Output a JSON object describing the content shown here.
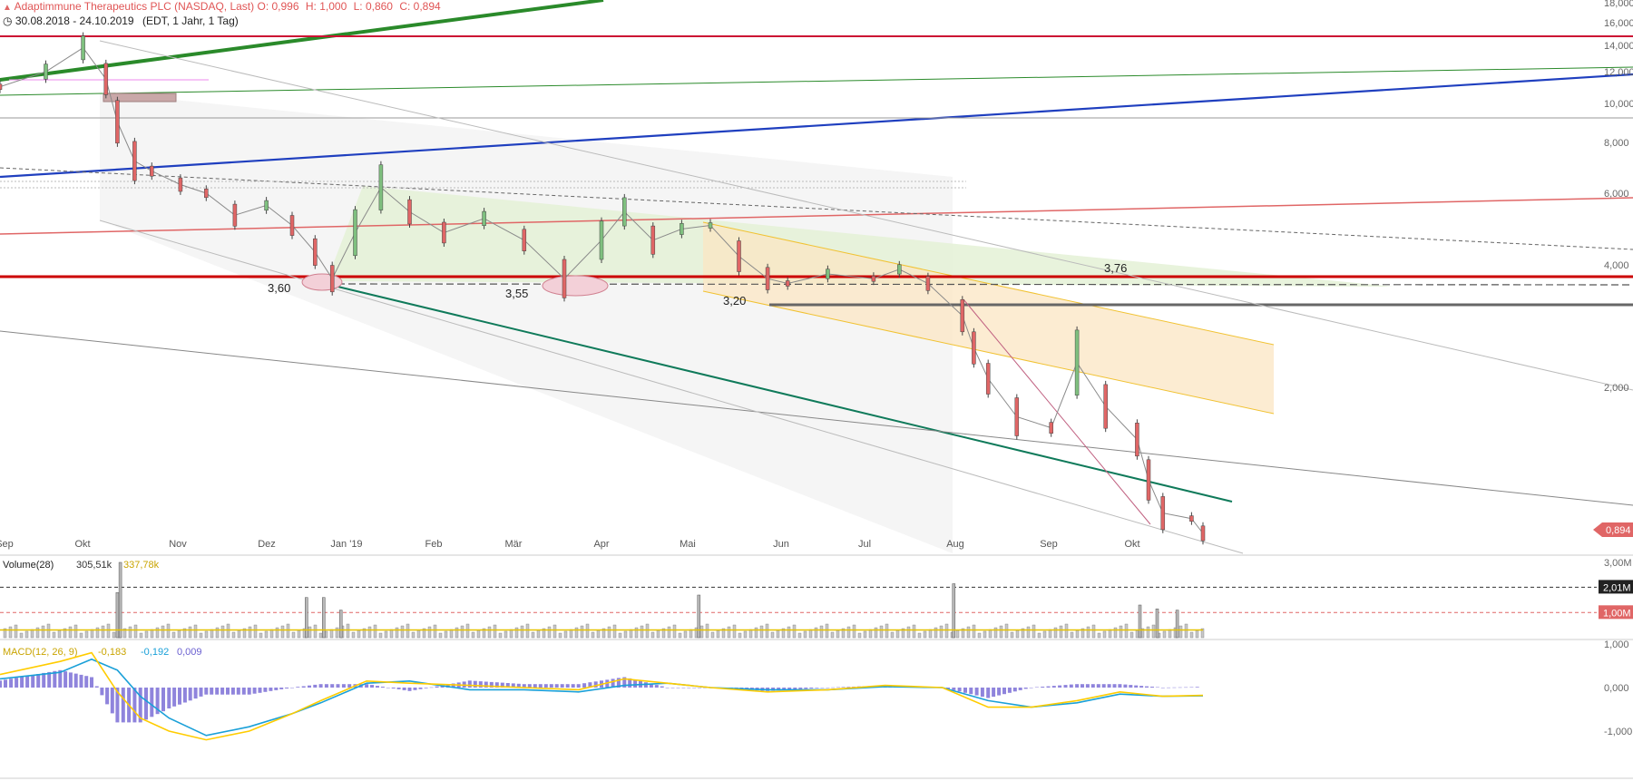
{
  "header": {
    "title": "Adaptimmune Therapeutics PLC (NASDAQ, Last)",
    "open_label": "O:",
    "open": "0,996",
    "high_label": "H:",
    "high": "1,000",
    "low_label": "L:",
    "low": "0,860",
    "close_label": "C:",
    "close": "0,894",
    "range": "30.08.2018 - 24.10.2019",
    "settings": "(EDT, 1 Jahr, 1 Tag)",
    "brand_icon": "tradingview-icon",
    "clock_icon": "clock-icon"
  },
  "colors": {
    "up": "#7fc07f",
    "down": "#e06666",
    "resistance": "#cc1133",
    "trend_blue": "#1f3fbf",
    "trend_green": "#2a8a2a",
    "support_teal": "#0f7a5a",
    "macd_line": "#ffcc00",
    "signal_line": "#1aa0d8",
    "histogram": "#7b6fd6"
  },
  "chart_data": [
    {
      "type": "line",
      "name": "price",
      "ylim": [
        0.7,
        18
      ],
      "yscale": "log",
      "y_ticks": [
        "2,000",
        "4,000",
        "6,000",
        "8,000",
        "10,000",
        "12,000",
        "14,000",
        "16,000",
        "18,000"
      ],
      "x_ticks": [
        "Sep",
        "Okt",
        "Nov",
        "Dez",
        "Jan '19",
        "Feb",
        "Mär",
        "Apr",
        "Mai",
        "Jun",
        "Jul",
        "Aug",
        "Sep",
        "Okt"
      ],
      "x": [
        "2018-08-30",
        "2018-09-15",
        "2018-09-28",
        "2018-10-06",
        "2018-10-10",
        "2018-10-16",
        "2018-10-22",
        "2018-11-01",
        "2018-11-10",
        "2018-11-20",
        "2018-12-01",
        "2018-12-10",
        "2018-12-18",
        "2018-12-24",
        "2019-01-01",
        "2019-01-10",
        "2019-01-20",
        "2019-02-01",
        "2019-02-15",
        "2019-03-01",
        "2019-03-15",
        "2019-03-28",
        "2019-04-05",
        "2019-04-15",
        "2019-04-25",
        "2019-05-05",
        "2019-05-15",
        "2019-05-25",
        "2019-06-01",
        "2019-06-15",
        "2019-07-01",
        "2019-07-10",
        "2019-07-20",
        "2019-08-01",
        "2019-08-05",
        "2019-08-10",
        "2019-08-20",
        "2019-09-01",
        "2019-09-10",
        "2019-09-20",
        "2019-10-01",
        "2019-10-05",
        "2019-10-10",
        "2019-10-20",
        "2019-10-24"
      ],
      "values": [
        11.0,
        12.0,
        13.8,
        11.5,
        9.0,
        7.2,
        6.8,
        6.3,
        6.0,
        5.3,
        5.6,
        5.0,
        4.3,
        3.7,
        4.8,
        6.2,
        5.4,
        4.8,
        5.2,
        4.6,
        3.7,
        4.6,
        5.4,
        4.6,
        4.9,
        5.0,
        4.2,
        3.7,
        3.6,
        3.8,
        3.7,
        3.9,
        3.6,
        3.0,
        2.5,
        2.1,
        1.7,
        1.6,
        2.3,
        1.8,
        1.5,
        1.2,
        1.0,
        0.97,
        0.894
      ],
      "annotations": [
        "3,60",
        "3,55",
        "3,20",
        "3,76"
      ],
      "last_value_label": "0,894"
    },
    {
      "type": "bar",
      "name": "Volume(28)",
      "legend": {
        "label": "Volume(28)",
        "v1": "305,51k",
        "v2": "337,78k"
      },
      "y_ticks": [
        "1,00M",
        "2,01M",
        "3,00M"
      ],
      "ref_labels": [
        "2,01M",
        "1,00M"
      ],
      "ylim": [
        0,
        3000000
      ],
      "avg": 305510,
      "spikes": [
        {
          "x": "2018-10-11",
          "value": 3000000
        },
        {
          "x": "2018-10-10",
          "value": 1800000
        },
        {
          "x": "2018-12-15",
          "value": 1600000
        },
        {
          "x": "2018-12-21",
          "value": 1600000
        },
        {
          "x": "2018-12-27",
          "value": 1100000
        },
        {
          "x": "2019-05-01",
          "value": 1700000
        },
        {
          "x": "2019-07-29",
          "value": 2150000
        },
        {
          "x": "2019-10-02",
          "value": 1300000
        },
        {
          "x": "2019-10-08",
          "value": 1150000
        },
        {
          "x": "2019-10-15",
          "value": 1100000
        }
      ]
    },
    {
      "type": "line",
      "name": "MACD(12, 26, 9)",
      "legend": {
        "label": "MACD(12, 26, 9)",
        "macd": "-0,183",
        "signal": "-0,192",
        "hist": "0,009"
      },
      "y_ticks": [
        "1,000",
        "0,000",
        "-1,000"
      ],
      "ylim": [
        -1.1,
        1.1
      ],
      "x": [
        "2018-08-30",
        "2018-09-20",
        "2018-10-01",
        "2018-10-10",
        "2018-10-18",
        "2018-10-28",
        "2018-11-10",
        "2018-11-25",
        "2018-12-10",
        "2018-12-20",
        "2019-01-05",
        "2019-01-20",
        "2019-02-10",
        "2019-03-01",
        "2019-03-20",
        "2019-04-05",
        "2019-04-20",
        "2019-05-05",
        "2019-05-25",
        "2019-06-15",
        "2019-07-05",
        "2019-07-25",
        "2019-08-10",
        "2019-08-25",
        "2019-09-10",
        "2019-09-25",
        "2019-10-10",
        "2019-10-24"
      ],
      "macd": [
        0.3,
        0.6,
        0.8,
        -0.1,
        -0.7,
        -1.0,
        -1.2,
        -1.0,
        -0.6,
        -0.3,
        0.15,
        0.1,
        0.05,
        0.0,
        -0.05,
        0.2,
        0.1,
        0.0,
        -0.1,
        -0.05,
        0.05,
        0.0,
        -0.45,
        -0.45,
        -0.3,
        -0.1,
        -0.2,
        -0.18
      ],
      "signal": [
        0.2,
        0.35,
        0.65,
        0.4,
        -0.2,
        -0.7,
        -1.1,
        -0.9,
        -0.6,
        -0.35,
        0.1,
        0.15,
        -0.05,
        -0.05,
        -0.1,
        0.05,
        0.1,
        0.0,
        -0.05,
        -0.05,
        0.02,
        0.0,
        -0.3,
        -0.45,
        -0.35,
        -0.15,
        -0.2,
        -0.19
      ]
    }
  ]
}
